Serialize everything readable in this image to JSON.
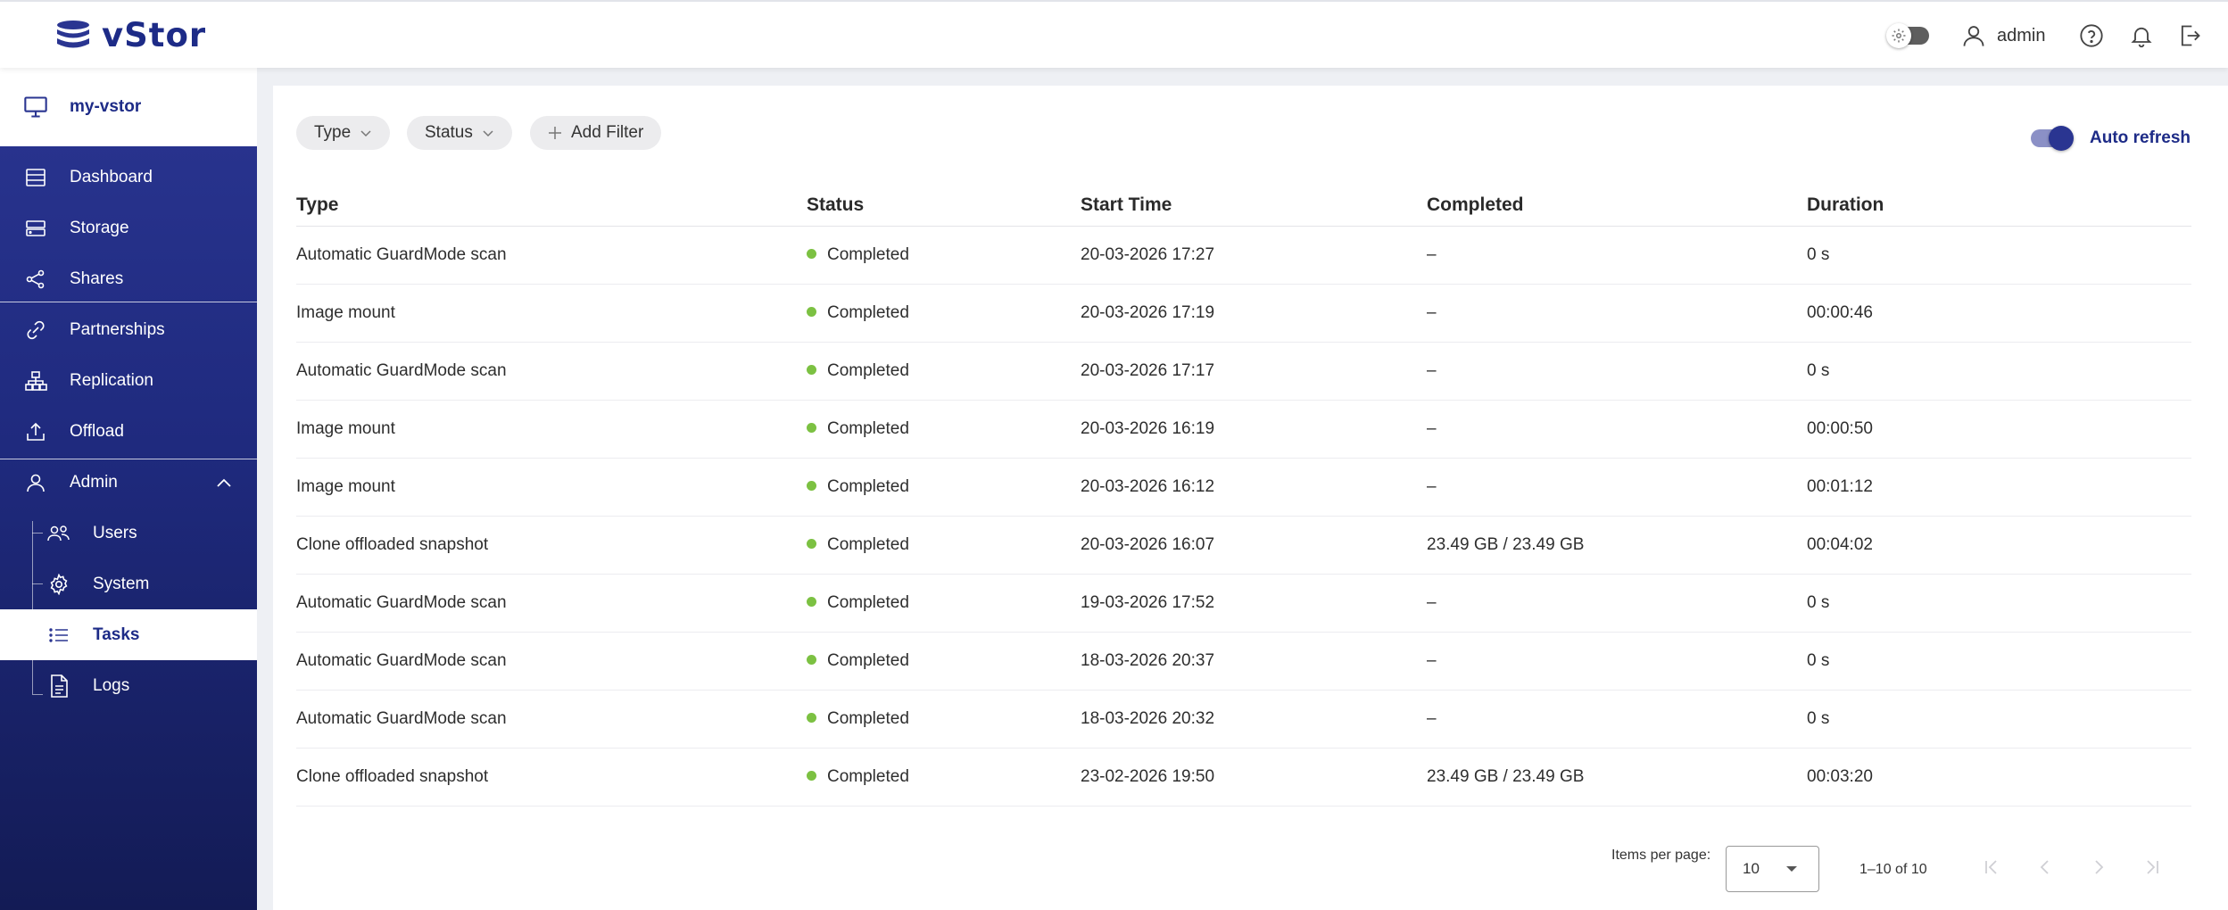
{
  "header": {
    "brand": "vStor",
    "user": "admin"
  },
  "sidebar": {
    "device": "my-vstor",
    "items": [
      {
        "label": "Dashboard"
      },
      {
        "label": "Storage"
      },
      {
        "label": "Shares"
      },
      {
        "label": "Partnerships"
      },
      {
        "label": "Replication"
      },
      {
        "label": "Offload"
      },
      {
        "label": "Admin"
      },
      {
        "label": "Users"
      },
      {
        "label": "System"
      },
      {
        "label": "Tasks"
      },
      {
        "label": "Logs"
      }
    ],
    "active": "Tasks"
  },
  "filters": {
    "type": "Type",
    "status": "Status",
    "add": "Add Filter"
  },
  "auto_refresh": {
    "label": "Auto refresh",
    "enabled": true
  },
  "table": {
    "columns": [
      "Type",
      "Status",
      "Start Time",
      "Completed",
      "Duration"
    ],
    "rows": [
      {
        "type": "Automatic GuardMode scan",
        "status": "Completed",
        "start": "20-03-2026 17:27",
        "completed": "–",
        "duration": "0 s"
      },
      {
        "type": "Image mount",
        "status": "Completed",
        "start": "20-03-2026 17:19",
        "completed": "–",
        "duration": "00:00:46"
      },
      {
        "type": "Automatic GuardMode scan",
        "status": "Completed",
        "start": "20-03-2026 17:17",
        "completed": "–",
        "duration": "0 s"
      },
      {
        "type": "Image mount",
        "status": "Completed",
        "start": "20-03-2026 16:19",
        "completed": "–",
        "duration": "00:00:50"
      },
      {
        "type": "Image mount",
        "status": "Completed",
        "start": "20-03-2026 16:12",
        "completed": "–",
        "duration": "00:01:12"
      },
      {
        "type": "Clone offloaded snapshot",
        "status": "Completed",
        "start": "20-03-2026 16:07",
        "completed": "23.49 GB / 23.49 GB",
        "duration": "00:04:02"
      },
      {
        "type": "Automatic GuardMode scan",
        "status": "Completed",
        "start": "19-03-2026 17:52",
        "completed": "–",
        "duration": "0 s"
      },
      {
        "type": "Automatic GuardMode scan",
        "status": "Completed",
        "start": "18-03-2026 20:37",
        "completed": "–",
        "duration": "0 s"
      },
      {
        "type": "Automatic GuardMode scan",
        "status": "Completed",
        "start": "18-03-2026 20:32",
        "completed": "–",
        "duration": "0 s"
      },
      {
        "type": "Clone offloaded snapshot",
        "status": "Completed",
        "start": "23-02-2026 19:50",
        "completed": "23.49 GB / 23.49 GB",
        "duration": "00:03:20"
      }
    ]
  },
  "pagination": {
    "items_per_page_label": "Items per page:",
    "items_per_page": "10",
    "range": "1–10 of 10"
  },
  "colors": {
    "brand": "#1d2b87",
    "status_completed": "#7cc142",
    "sidebar_bg": "#1f2a7e"
  }
}
